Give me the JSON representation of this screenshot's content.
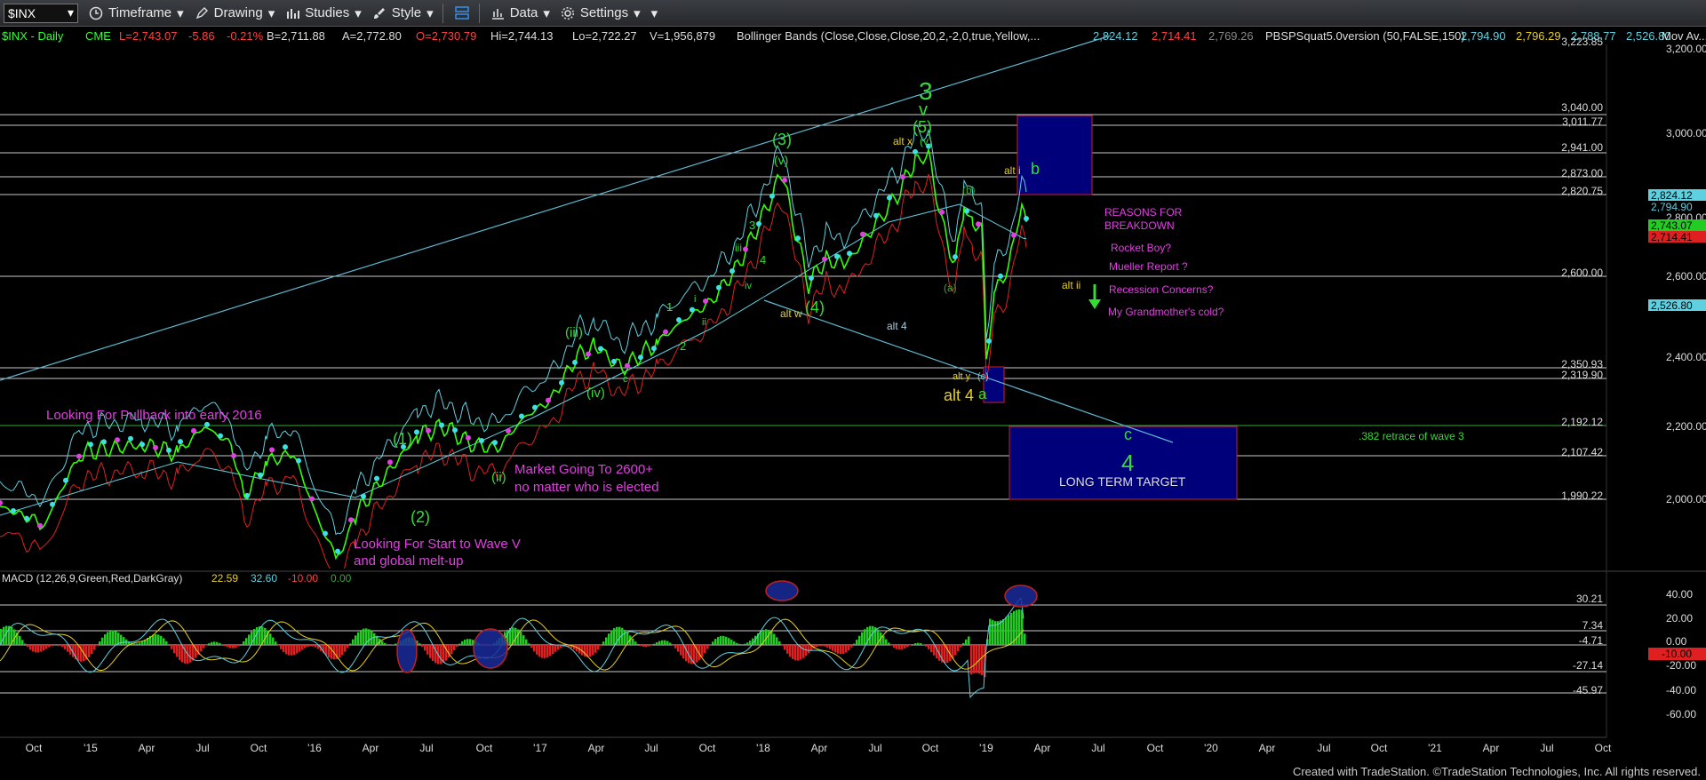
{
  "toolbar": {
    "symbol": "$INX",
    "timeframe": "Timeframe",
    "drawing": "Drawing",
    "studies": "Studies",
    "style": "Style",
    "data": "Data",
    "settings": "Settings"
  },
  "header": {
    "symbol_line": "$INX - Daily",
    "exchange": "CME",
    "last": "L=2,743.07",
    "change": "-5.86",
    "change_pct": "-0.21%",
    "bid": "B=2,711.88",
    "ask": "A=2,772.80",
    "open": "O=2,730.79",
    "high": "Hi=2,744.13",
    "low": "Lo=2,722.27",
    "volume": "V=1,956,879",
    "bb_label": "Bollinger Bands (Close,Close,Close,20,2,-2,0,true,Yellow,...",
    "bb_upper": "2,824.12",
    "bb_lower": "2,714.41",
    "bb_mid": "2,769.26",
    "pbs_label": "PBSPSquat5.0version (50,FALSE,150)",
    "pbs_v1": "2,794.90",
    "pbs_v2": "2,796.29",
    "pbs_v3": "2,788.77",
    "pbs_v4": "2,526.80",
    "mov_av": "Mov Av..."
  },
  "price_axis": {
    "ticks": [
      "3,200.00",
      "3,000.00",
      "2,800.00",
      "2,600.00",
      "2,400.00",
      "2,200.00",
      "2,000.00"
    ],
    "levels": [
      "3,223.85",
      "3,040.00",
      "3,011.77",
      "2,941.00",
      "2,873.00",
      "2,820.75",
      "2,600.00",
      "2,350.93",
      "2,319.90",
      "2,192.12",
      "2,107.42",
      "1,990.22"
    ],
    "badges": [
      "2,824.12",
      "2,794.90",
      "2,743.07",
      "2,714.41",
      "2,526.80"
    ]
  },
  "macd": {
    "label": "MACD (12,26,9,Green,Red,DarkGray)",
    "v1": "22.59",
    "v2": "32.60",
    "v3": "-10.00",
    "v4": "0.00",
    "ticks": [
      "40.00",
      "20.00",
      "0.00",
      "-20.00",
      "-40.00",
      "-60.00"
    ],
    "levels": [
      "30.21",
      "7.34",
      "-4.71",
      "-27.14",
      "-45.97"
    ],
    "badge": "-10.00"
  },
  "time_axis": [
    "Oct",
    "'15",
    "Apr",
    "Jul",
    "Oct",
    "'16",
    "Apr",
    "Jul",
    "Oct",
    "'17",
    "Apr",
    "Jul",
    "Oct",
    "'18",
    "Apr",
    "Jul",
    "Oct",
    "'19",
    "Apr",
    "Jul",
    "Oct",
    "'20",
    "Apr",
    "Jul",
    "Oct",
    "'21",
    "Apr",
    "Jul",
    "Oct"
  ],
  "annotations": {
    "pullback": "Looking For Pullback into early 2016",
    "start_wave_v_1": "Looking For Start to Wave V",
    "start_wave_v_2": "and global melt-up",
    "market_2600_1": "Market Going To 2600+",
    "market_2600_2": "no matter who is elected",
    "reasons_1": "REASONS FOR",
    "reasons_2": "BREAKDOWN",
    "rocket": "Rocket Boy?",
    "mueller": "Mueller Report ?",
    "recession": "Recession Concerns?",
    "grandmother": "My Grandmother's cold?",
    "retrace": ".382 retrace of wave 3",
    "long_term": "LONG TERM TARGET",
    "w1": "(1)",
    "w2": "(2)",
    "w3": "(3)",
    "w4": "(4)",
    "w5": "(5)",
    "big3": "3",
    "bigv": "v",
    "big4": "4",
    "c_big": "c",
    "iii": "(iii)",
    "iv": "(iv)",
    "ii": "(ii)",
    "v_small": "(v)",
    "alt_x": "alt x",
    "v_paren": "(v)",
    "alt_i": "alt i",
    "b": "b",
    "b_paren": "(b)",
    "a_paren": "(a)",
    "alt_w": "alt w",
    "alt_4_small": "alt 4",
    "alt_y": "alt y",
    "c_paren": "(c)",
    "alt_4": "alt 4",
    "a": "a",
    "alt_ii": "alt ii",
    "l_iii": "iii",
    "l_3": "3",
    "l_4": "4",
    "l_iv": "iv",
    "l_1": "1",
    "l_2": "2",
    "l_i": "i",
    "l_ii": "ii",
    "l_c": "c"
  },
  "credit": "Created with TradeStation. ©TradeStation Technologies, Inc. All rights reserved.",
  "colors": {
    "background": "#000000",
    "price": "#33ff00",
    "bb_upper": "#5fd0e0",
    "bb_lower": "#e02020",
    "wave_label": "#33dd33",
    "annotation": "#e040e0",
    "alt_label": "#e6d020",
    "box": "#000080",
    "level_line": "#c8c8c8"
  }
}
